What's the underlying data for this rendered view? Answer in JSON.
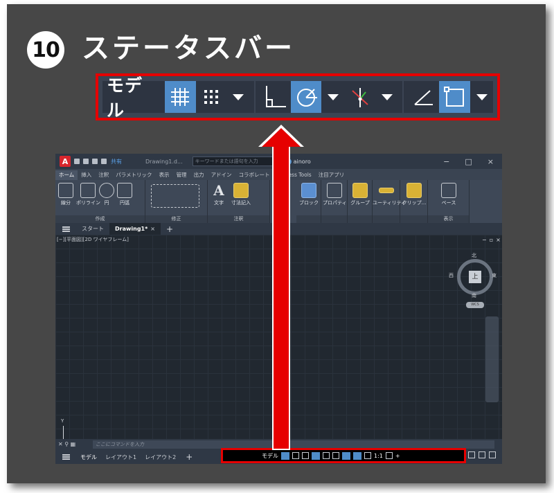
{
  "step": {
    "number": "10",
    "title": "ステータスバー"
  },
  "zoom_statusbar": {
    "model_label": "モデル",
    "tools": [
      {
        "icon": "grid-icon",
        "active": true
      },
      {
        "icon": "snap-icon",
        "active": false
      },
      {
        "icon": "ortho-icon",
        "active": false
      },
      {
        "icon": "polar-icon",
        "active": true
      },
      {
        "icon": "isodraft-icon",
        "active": false
      },
      {
        "icon": "object-snap-tracking-icon",
        "active": false
      },
      {
        "icon": "object-snap-icon",
        "active": true
      }
    ]
  },
  "app": {
    "title": {
      "logo": "A",
      "share": "共有",
      "document": "Drawing1.d...",
      "search_placeholder": "キーワードまたは語句を入力",
      "user": "ainoro"
    },
    "ribbon_tabs": [
      "ホーム",
      "挿入",
      "注釈",
      "パラメトリック",
      "表示",
      "管理",
      "出力",
      "アドイン",
      "コラボレート",
      "Express Tools",
      "注目アプリ"
    ],
    "ribbon_groups": {
      "draw": {
        "label": "作成",
        "tools": [
          "線分",
          "ポリライン",
          "円",
          "円弧"
        ]
      },
      "modify": {
        "label": "修正"
      },
      "annotation": {
        "label": "注釈",
        "tools": [
          "文字",
          "寸法記入"
        ]
      },
      "block": "ブロック",
      "properties": "プロパティ",
      "groups": "グループ",
      "utilities": "ユーティリティ",
      "clipboard": "クリップ...",
      "base": "ベース",
      "view": "表示"
    },
    "doc_tabs": {
      "start": "スタート",
      "drawing": "Drawing1*"
    },
    "viewport_label": "[−][平面図][2D ワイヤフレーム]",
    "viewcube": {
      "top": "上",
      "north": "北",
      "south": "南",
      "west": "西",
      "east": "東",
      "wcs": "WCS"
    },
    "ucs_axis": "Y",
    "command_placeholder": "ここにコマンドを入力",
    "layout_tabs": [
      "モデル",
      "レイアウト1",
      "レイアウト2"
    ],
    "status_model": "モデル",
    "scale": "1:1"
  }
}
